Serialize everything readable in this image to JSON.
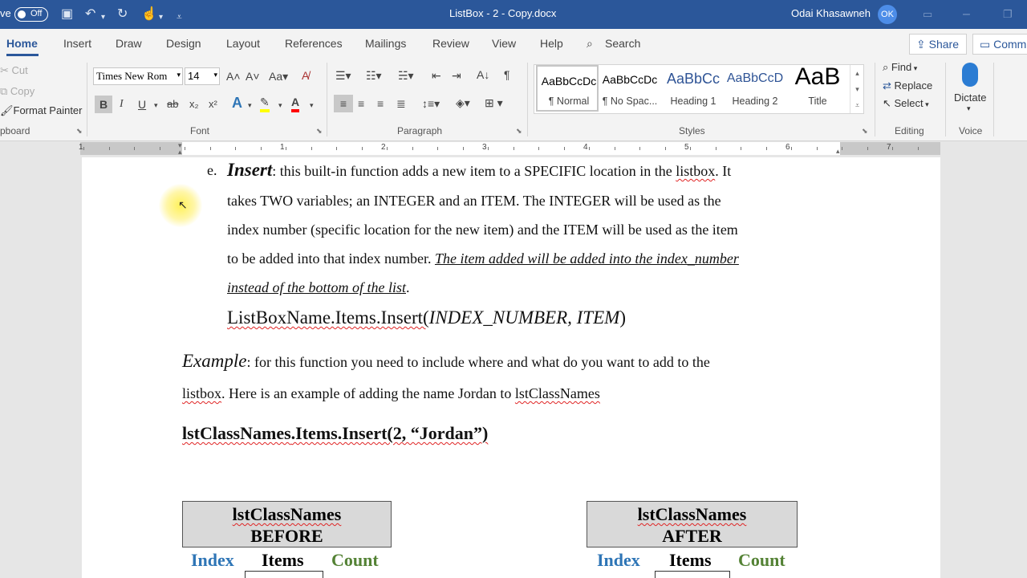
{
  "titlebar": {
    "autosave_label": "ve",
    "toggle_state": "Off",
    "doc_title": "ListBox - 2 - Copy.docx",
    "user_name": "Odai Khasawneh",
    "user_initials": "OK"
  },
  "tabs": [
    "Home",
    "Insert",
    "Draw",
    "Design",
    "Layout",
    "References",
    "Mailings",
    "Review",
    "View",
    "Help"
  ],
  "search_label": "Search",
  "share_label": "Share",
  "comments_label": "Comm",
  "clipboard": {
    "cut": "Cut",
    "copy": "Copy",
    "format_painter": "Format Painter",
    "group_label": "pboard"
  },
  "font": {
    "name": "Times New Rom",
    "size": "14",
    "group_label": "Font",
    "bold": "B",
    "italic": "I",
    "underline": "U",
    "strike": "ab",
    "sub": "x₂",
    "sup": "x²",
    "change_case": "Aa"
  },
  "paragraph": {
    "group_label": "Paragraph"
  },
  "styles": {
    "group_label": "Styles",
    "items": [
      {
        "preview": "AaBbCcDc",
        "name": "¶ Normal",
        "color": "#000000"
      },
      {
        "preview": "AaBbCcDc",
        "name": "¶ No Spac...",
        "color": "#000000"
      },
      {
        "preview": "AaBbCc",
        "name": "Heading 1",
        "color": "#2f5496"
      },
      {
        "preview": "AaBbCcD",
        "name": "Heading 2",
        "color": "#2f5496"
      },
      {
        "preview": "AaB",
        "name": "Title",
        "color": "#000000"
      }
    ]
  },
  "editing": {
    "find": "Find",
    "replace": "Replace",
    "select": "Select",
    "group_label": "Editing"
  },
  "voice": {
    "dictate": "Dictate",
    "group_label": "Voice"
  },
  "ruler_numbers": [
    "1",
    "1",
    "2",
    "3",
    "4",
    "5",
    "6",
    "7"
  ],
  "document": {
    "list_marker": "e.",
    "insert_word": "Insert",
    "line1_rest_a": ": this built-in function adds a new item to a SPECIFIC location in the ",
    "listbox_word": "listbox",
    "line1_rest_b": ". It",
    "line2": "takes TWO variables; an INTEGER and an ITEM. The INTEGER will be used as the",
    "line3": "index number (specific location for the new item) and the ITEM will be used as the item",
    "line4_plain": "to be added into that index number. ",
    "line4_italic": "The item added will be added into the index_number",
    "line5_italic": "instead of the bottom of the list",
    "line5_end": ".",
    "syntax_prefix": "ListBoxName.Items.Insert(",
    "syntax_args": "INDEX_NUMBER, ITEM",
    "syntax_suffix": ")",
    "example_word": "Example",
    "example_rest": ": for this function you need to include where and what do you want to add to the",
    "example_line2_a": "listbox",
    "example_line2_b": ". Here is an example of adding the name Jordan to ",
    "example_line2_c": "lstClassNames",
    "code_a": "lstClassNames",
    "code_b": ".Items.Insert(2, “Jordan”)",
    "table_before_title": "lstClassNames",
    "table_before_sub": "BEFORE",
    "table_after_title": "lstClassNames",
    "table_after_sub": "AFTER",
    "col_index": "Index",
    "col_items": "Items",
    "col_count": "Count"
  },
  "colors": {
    "word_blue": "#2b579a",
    "index_blue": "#2e75b6",
    "count_green": "#548235"
  }
}
